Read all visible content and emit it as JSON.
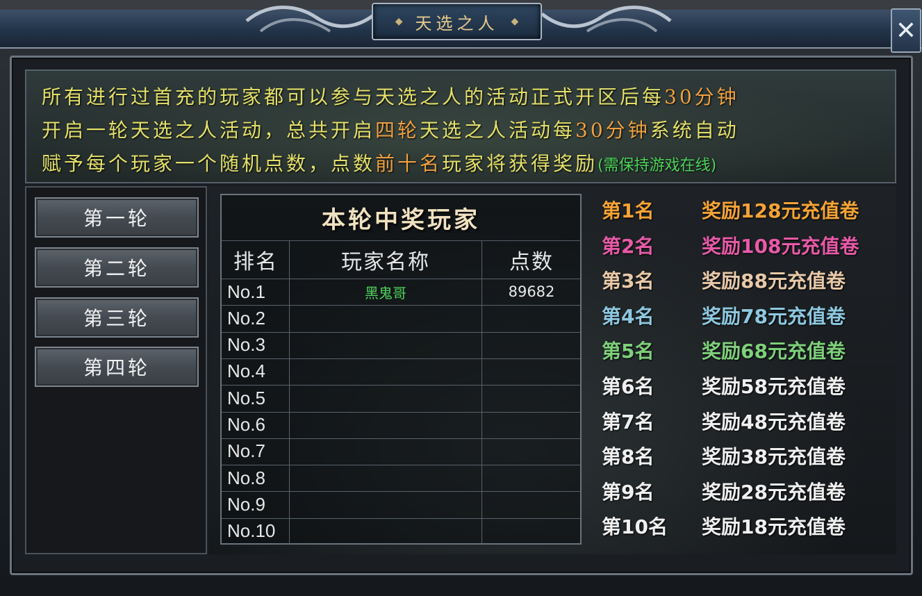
{
  "window": {
    "title": "天选之人",
    "close_label": "✕"
  },
  "description": {
    "line1": {
      "a": "所有进行过首充的玩家都可以参与天选之人的活动正式开区后每",
      "b": "30分钟"
    },
    "line2": {
      "a": "开启一轮天选之人活动，总共开启",
      "b": "四轮",
      "c": "天选之人活动每",
      "d": "30分钟",
      "e": "系统自动"
    },
    "line3": {
      "a": "赋予每个玩家一个随机点数，点数",
      "b": "前十名",
      "c": "玩家将获得奖励",
      "d": "(需保持游戏在线)"
    }
  },
  "rounds": [
    {
      "label": "第一轮"
    },
    {
      "label": "第二轮"
    },
    {
      "label": "第三轮"
    },
    {
      "label": "第四轮"
    }
  ],
  "table": {
    "title": "本轮中奖玩家",
    "headers": {
      "rank": "排名",
      "name": "玩家名称",
      "score": "点数"
    },
    "rows": [
      {
        "rank": "No.1",
        "name": "黑鬼哥",
        "score": "89682"
      },
      {
        "rank": "No.2",
        "name": "",
        "score": ""
      },
      {
        "rank": "No.3",
        "name": "",
        "score": ""
      },
      {
        "rank": "No.4",
        "name": "",
        "score": ""
      },
      {
        "rank": "No.5",
        "name": "",
        "score": ""
      },
      {
        "rank": "No.6",
        "name": "",
        "score": ""
      },
      {
        "rank": "No.7",
        "name": "",
        "score": ""
      },
      {
        "rank": "No.8",
        "name": "",
        "score": ""
      },
      {
        "rank": "No.9",
        "name": "",
        "score": ""
      },
      {
        "rank": "No.10",
        "name": "",
        "score": ""
      }
    ]
  },
  "rewards": [
    {
      "rank": "第1名",
      "reward": "奖励128元充值卷",
      "color": "#f5a335"
    },
    {
      "rank": "第2名",
      "reward": "奖励108元充值卷",
      "color": "#e85aa8"
    },
    {
      "rank": "第3名",
      "reward": "奖励88元充值卷",
      "color": "#e8c9a8"
    },
    {
      "rank": "第4名",
      "reward": "奖励78元充值卷",
      "color": "#8ec8e0"
    },
    {
      "rank": "第5名",
      "reward": "奖励68元充值卷",
      "color": "#7ed07a"
    },
    {
      "rank": "第6名",
      "reward": "奖励58元充值卷",
      "color": "#f0f0f0"
    },
    {
      "rank": "第7名",
      "reward": "奖励48元充值卷",
      "color": "#f0f0f0"
    },
    {
      "rank": "第8名",
      "reward": "奖励38元充值卷",
      "color": "#f0f0f0"
    },
    {
      "rank": "第9名",
      "reward": "奖励28元充值卷",
      "color": "#f0f0f0"
    },
    {
      "rank": "第10名",
      "reward": "奖励18元充值卷",
      "color": "#f0f0f0"
    }
  ],
  "colors": {
    "desc_text": "#e4e06a",
    "desc_highlight": "#f0a040",
    "online_note": "#4dd35a",
    "player_name": "#4fd15a"
  }
}
